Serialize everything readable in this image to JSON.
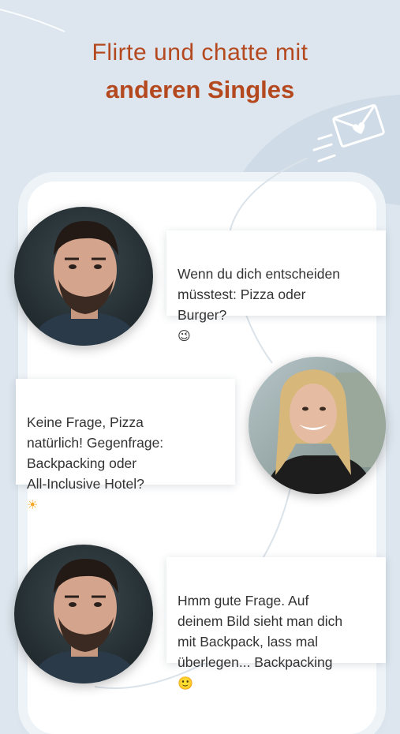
{
  "headline": {
    "line1": "Flirte und chatte mit",
    "line2": "anderen Singles"
  },
  "decor": {
    "envelope_icon": "envelope-heart-icon",
    "accent_color": "#b4481e"
  },
  "chat": {
    "messages": [
      {
        "sender": "man",
        "text": "Wenn du dich entscheiden\nmüsstest: Pizza oder\nBurger?",
        "emoji": "😉"
      },
      {
        "sender": "woman",
        "text": "Keine Frage, Pizza\nnatürlich! Gegenfrage:\nBackpacking oder\nAll-Inclusive Hotel?",
        "emoji": "☀"
      },
      {
        "sender": "man",
        "text": "Hmm gute Frage. Auf\ndeinem Bild sieht man dich\nmit Backpack, lass mal\nüberlegen... Backpacking",
        "emoji": "🙂"
      }
    ]
  }
}
